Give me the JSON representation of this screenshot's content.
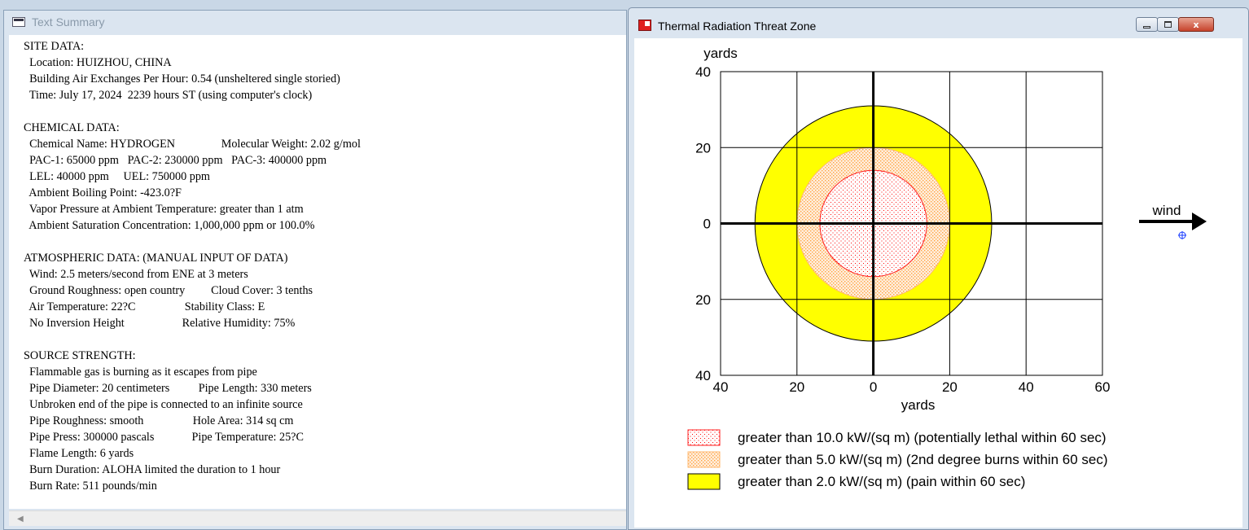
{
  "left_window": {
    "title": "Text Summary",
    "lines": [
      "SITE DATA:",
      "  Location: HUIZHOU, CHINA",
      "  Building Air Exchanges Per Hour: 0.54 (unsheltered single storied)",
      "  Time: July 17, 2024  2239 hours ST (using computer's clock)",
      "",
      "CHEMICAL DATA:",
      "  Chemical Name: HYDROGEN                Molecular Weight: 2.02 g/mol",
      "  PAC-1: 65000 ppm   PAC-2: 230000 ppm   PAC-3: 400000 ppm",
      "  LEL: 40000 ppm     UEL: 750000 ppm",
      "  Ambient Boiling Point: -423.0?F",
      "  Vapor Pressure at Ambient Temperature: greater than 1 atm",
      "  Ambient Saturation Concentration: 1,000,000 ppm or 100.0%",
      "",
      "ATMOSPHERIC DATA: (MANUAL INPUT OF DATA)",
      "  Wind: 2.5 meters/second from ENE at 3 meters",
      "  Ground Roughness: open country         Cloud Cover: 3 tenths",
      "  Air Temperature: 22?C                 Stability Class: E",
      "  No Inversion Height                    Relative Humidity: 75%",
      "",
      "SOURCE STRENGTH:",
      "  Flammable gas is burning as it escapes from pipe",
      "  Pipe Diameter: 20 centimeters          Pipe Length: 330 meters",
      "  Unbroken end of the pipe is connected to an infinite source",
      "  Pipe Roughness: smooth                 Hole Area: 314 sq cm",
      "  Pipe Press: 300000 pascals             Pipe Temperature: 25?C",
      "  Flame Length: 6 yards",
      "  Burn Duration: ALOHA limited the duration to 1 hour",
      "  Burn Rate: 511 pounds/min"
    ]
  },
  "right_window": {
    "title": "Thermal Radiation Threat Zone",
    "buttons": {
      "minimize": "minimize",
      "maximize": "maximize",
      "close": "x"
    }
  },
  "chart_data": {
    "type": "threat-zone",
    "ylabel": "yards",
    "xlabel": "yards",
    "x_ticks": [
      "40",
      "20",
      "0",
      "20",
      "40",
      "60"
    ],
    "x_tick_values": [
      -40,
      -20,
      0,
      20,
      40,
      60
    ],
    "y_ticks": [
      "40",
      "20",
      "0",
      "20",
      "40"
    ],
    "y_tick_values": [
      40,
      20,
      0,
      -20,
      -40
    ],
    "xlim": [
      -40,
      60
    ],
    "ylim": [
      -40,
      40
    ],
    "grid": true,
    "wind_label": "wind",
    "zones": [
      {
        "label": "greater than 10.0 kW/(sq m) (potentially lethal within 60 sec)",
        "radius_yards": 14,
        "style": "red-dots",
        "color": "#ff0000"
      },
      {
        "label": "greater than 5.0 kW/(sq m) (2nd degree burns within 60 sec)",
        "radius_yards": 20,
        "style": "orange-dots",
        "color": "#ff8c1a"
      },
      {
        "label": "greater than 2.0 kW/(sq m) (pain within 60 sec)",
        "radius_yards": 31,
        "style": "yellow-fill",
        "color": "#ffff00"
      }
    ]
  }
}
